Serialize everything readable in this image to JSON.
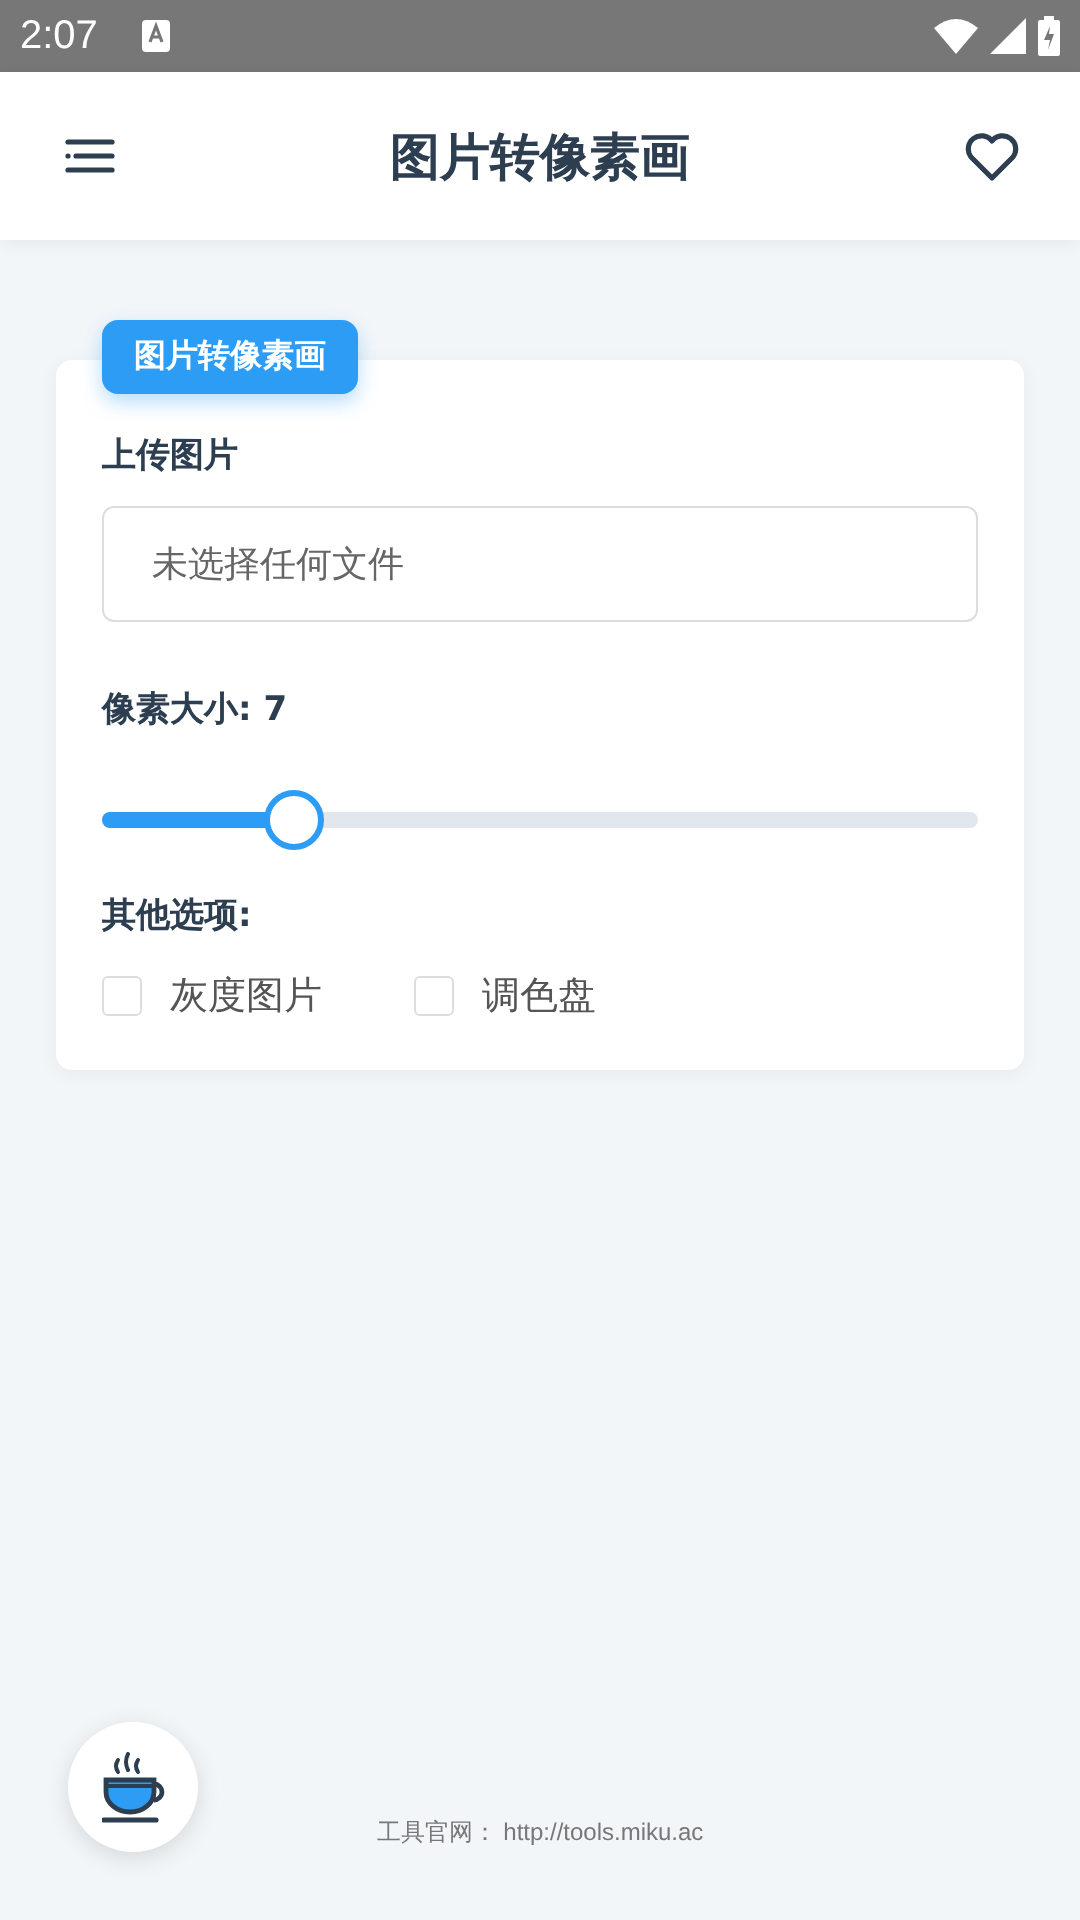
{
  "status_bar": {
    "time": "2:07"
  },
  "header": {
    "title": "图片转像素画"
  },
  "card": {
    "badge": "图片转像素画",
    "upload_label": "上传图片",
    "file_field": {
      "placeholder": "未选择任何文件"
    },
    "pixel_size_label": "像素大小: 7",
    "slider": {
      "level": 0.22
    },
    "options_label": "其他选项:",
    "options": [
      {
        "label": "灰度图片",
        "checked": false
      },
      {
        "label": "调色盘",
        "checked": false
      }
    ]
  },
  "footer": {
    "label": "工具官网：",
    "link": "http://tools.miku.ac"
  }
}
